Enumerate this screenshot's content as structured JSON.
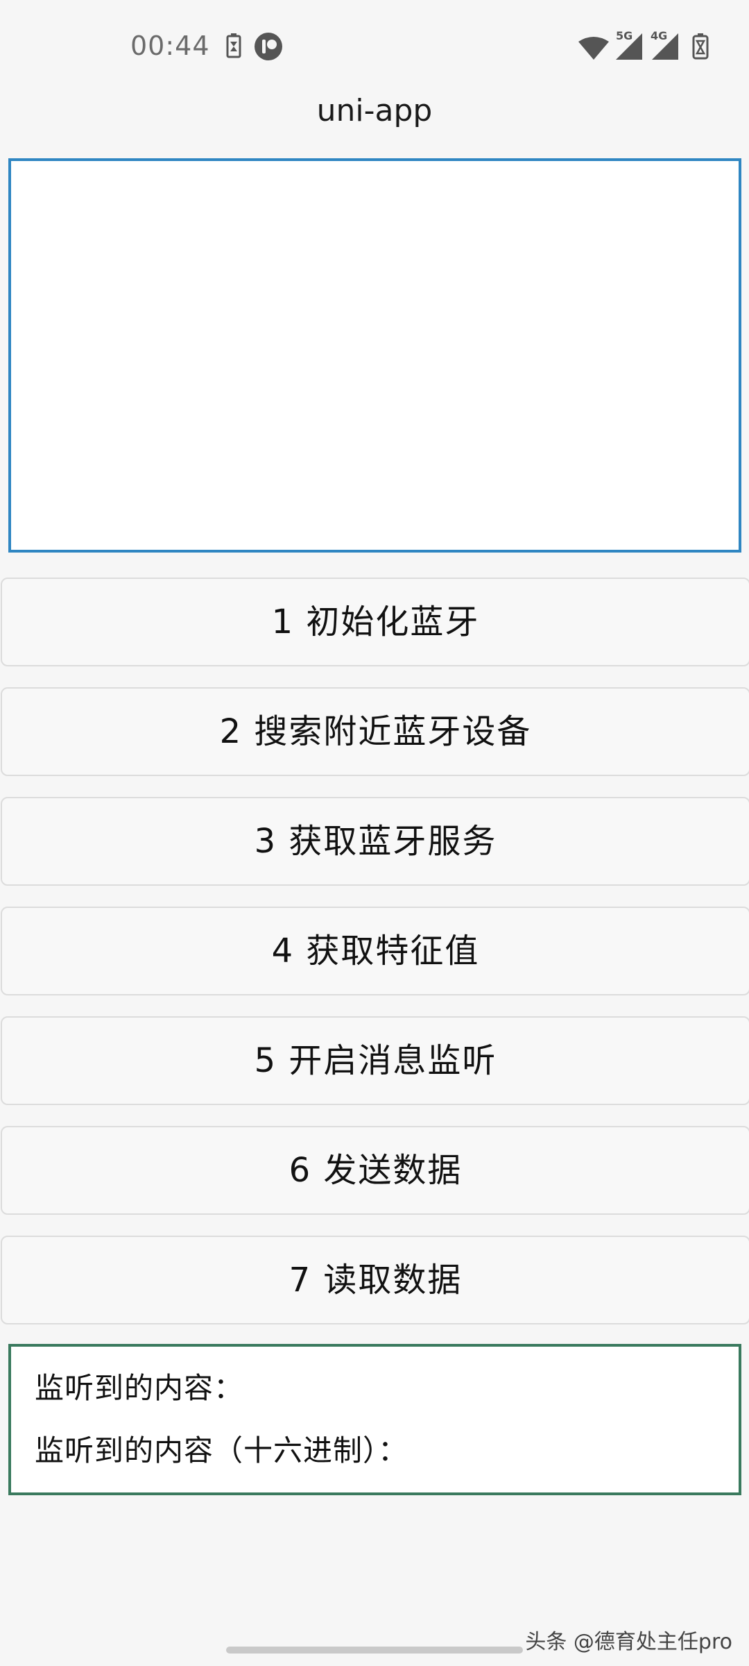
{
  "status_bar": {
    "time": "00:44",
    "icons": [
      "battery-saver-icon",
      "app-notification-icon",
      "wifi-icon",
      "signal-5g-icon",
      "signal-4g-icon",
      "battery-icon"
    ],
    "net1": "5G",
    "net2": "4G"
  },
  "nav": {
    "title": "uni-app"
  },
  "buttons": [
    {
      "label": "1 初始化蓝牙"
    },
    {
      "label": "2 搜索附近蓝牙设备"
    },
    {
      "label": "3 获取蓝牙服务"
    },
    {
      "label": "4 获取特征值"
    },
    {
      "label": "5 开启消息监听"
    },
    {
      "label": "6 发送数据"
    },
    {
      "label": "7 读取数据"
    }
  ],
  "listen": {
    "content_label": "监听到的内容：",
    "hex_label": "监听到的内容（十六进制）："
  },
  "watermark": "头条 @德育处主任pro",
  "colors": {
    "display_border": "#2f86c2",
    "listen_border": "#3a7a5e"
  }
}
